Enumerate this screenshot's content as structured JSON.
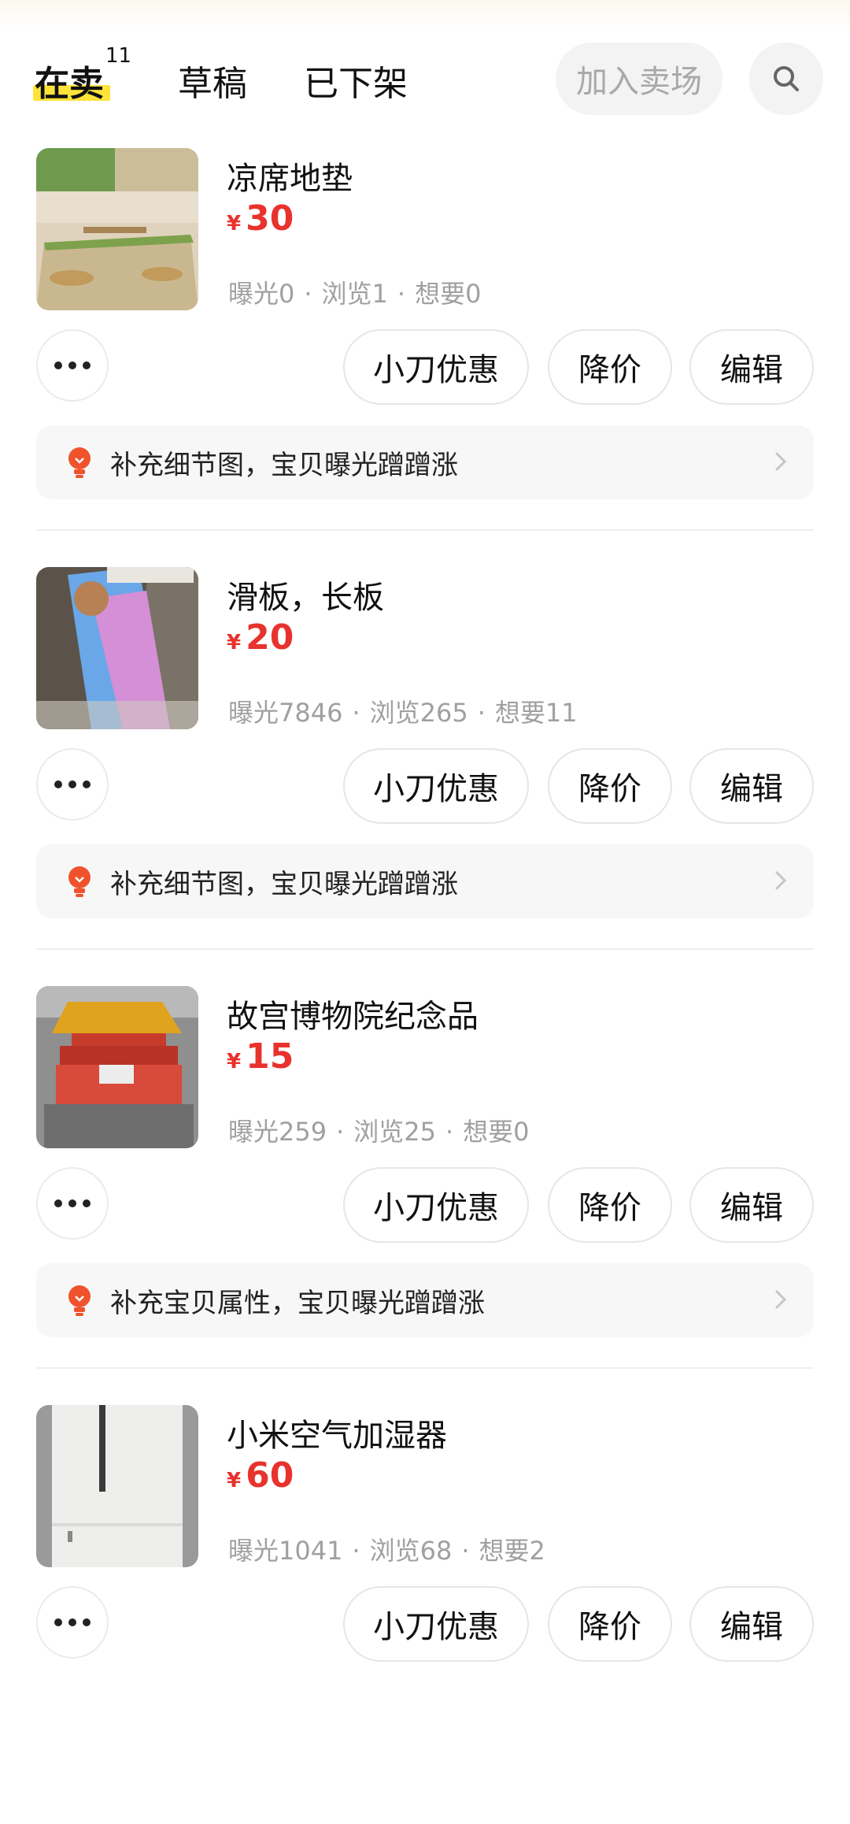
{
  "tabs": {
    "selling": "在卖",
    "selling_count": "11",
    "drafts": "草稿",
    "delisted": "已下架",
    "join_market": "加入卖场"
  },
  "actions": {
    "discount": "小刀优惠",
    "reduce_price": "降价",
    "edit": "编辑"
  },
  "currency": "¥",
  "items": [
    {
      "title": "凉席地垫",
      "price": "30",
      "stats": [
        "曝光0",
        "浏览1",
        "想要0"
      ],
      "tip": "补充细节图，宝贝曝光蹭蹭涨"
    },
    {
      "title": "滑板，长板",
      "price": "20",
      "stats": [
        "曝光7846",
        "浏览265",
        "想要11"
      ],
      "tip": "补充细节图，宝贝曝光蹭蹭涨"
    },
    {
      "title": "故宫博物院纪念品",
      "price": "15",
      "stats": [
        "曝光259",
        "浏览25",
        "想要0"
      ],
      "tip": "补充宝贝属性，宝贝曝光蹭蹭涨"
    },
    {
      "title": "小米空气加湿器",
      "price": "60",
      "stats": [
        "曝光1041",
        "浏览68",
        "想要2"
      ],
      "tip": ""
    }
  ],
  "colors": {
    "price": "#e8322d",
    "tab_highlight": "#ffe33a",
    "tip_icon": "#f0522d"
  }
}
